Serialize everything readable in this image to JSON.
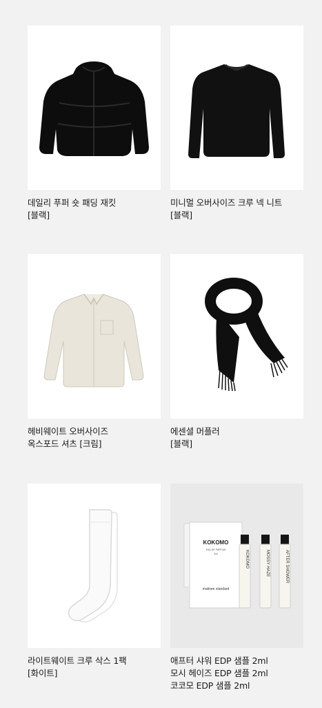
{
  "products": [
    {
      "name": "데일리 푸퍼 숏 패딩 재킷\n[블랙]",
      "image": "black-puffer-jacket"
    },
    {
      "name": "미니멀 오버사이즈 크루 넥 니트\n[블랙]",
      "image": "black-knit-sweater"
    },
    {
      "name": "헤비웨이트 오버사이즈\n옥스포드 셔츠 [크림]",
      "image": "cream-oxford-shirt"
    },
    {
      "name": "에센셜 머플러\n[블랙]",
      "image": "black-muffler"
    },
    {
      "name": "라이트웨이트 크루 삭스 1팩\n[화이트]",
      "image": "white-crew-socks"
    },
    {
      "name": "애프터 샤워 EDP 샘플 2ml\n모시 헤이즈 EDP 샘플 2ml\n코코모 EDP 샘플 2ml",
      "image": "perfume-sample-set"
    }
  ],
  "perfume_box": {
    "brand": "KOKOMO",
    "subtitle": "EAU DE PARFUM",
    "volume": "2ml",
    "footer": "matinee standard",
    "vials": [
      "KOKOMO",
      "MOSSY HAZE",
      "AFTER SHOWER"
    ]
  }
}
